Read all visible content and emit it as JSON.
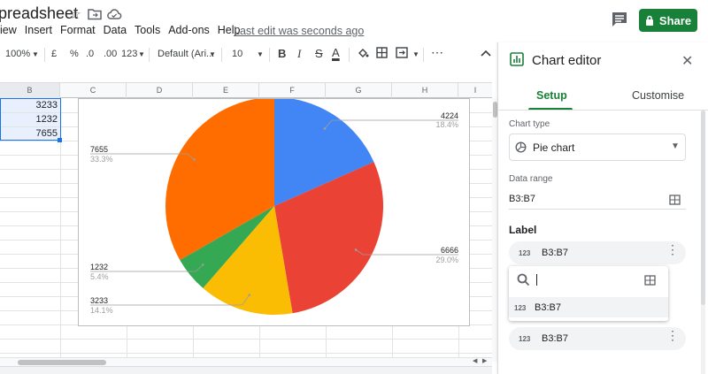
{
  "app": {
    "title": "preadsheet",
    "last_edit": "Last edit was seconds ago",
    "share_label": "Share",
    "accent": "#188038"
  },
  "menu": [
    "iew",
    "Insert",
    "Format",
    "Data",
    "Tools",
    "Add-ons",
    "Help"
  ],
  "toolbar": {
    "zoom": "100%",
    "currency": "£",
    "percent": "%",
    "decimal_less": ".0",
    "decimal_more": ".00",
    "format_more": "123",
    "font": "Default (Ari...",
    "font_size": "10",
    "bold": "B",
    "italic": "I",
    "strike": "S",
    "text_color": "A",
    "more": "⋯"
  },
  "grid": {
    "columns": [
      "B",
      "C",
      "D",
      "E",
      "F",
      "G",
      "H",
      "I"
    ],
    "cells_b": [
      "3233",
      "1232",
      "7655"
    ]
  },
  "chart_data": {
    "type": "pie",
    "title": "",
    "slices": [
      {
        "value": 4224,
        "pct": "18.4%",
        "color": "#4285f4"
      },
      {
        "value": 6666,
        "pct": "29.0%",
        "color": "#ea4335"
      },
      {
        "value": 3233,
        "pct": "14.1%",
        "color": "#fbbc04"
      },
      {
        "value": 1232,
        "pct": "5.4%",
        "color": "#34a853"
      },
      {
        "value": 7655,
        "pct": "33.3%",
        "color": "#ff6d01"
      }
    ],
    "labels": {
      "s0": {
        "value": "4224",
        "pct": "18.4%"
      },
      "s1": {
        "value": "6666",
        "pct": "29.0%"
      },
      "s2": {
        "value": "3233",
        "pct": "14.1%"
      },
      "s3": {
        "value": "1232",
        "pct": "5.4%"
      },
      "s4": {
        "value": "7655",
        "pct": "33.3%"
      }
    }
  },
  "editor": {
    "title": "Chart editor",
    "tabs": [
      "Setup",
      "Customise"
    ],
    "chart_type_label": "Chart type",
    "chart_type_value": "Pie chart",
    "data_range_label": "Data range",
    "data_range_value": "B3:B7",
    "label_heading": "Label",
    "chip_icon": "123",
    "label_chip": "B3:B7",
    "dropdown_option": "B3:B7",
    "value_chip": "B3:B7"
  }
}
